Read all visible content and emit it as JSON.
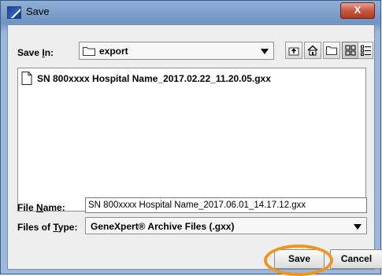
{
  "window": {
    "title": "Save",
    "close_label": "X"
  },
  "save_in": {
    "label_prefix": "Save ",
    "label_mnemonic": "I",
    "label_suffix": "n:",
    "value": "export"
  },
  "toolbar": {
    "icons": [
      "up-folder-icon",
      "home-icon",
      "new-folder-icon",
      "list-view-icon",
      "details-view-icon"
    ],
    "active": "list-view-icon"
  },
  "file_list": {
    "items": [
      {
        "name": "SN 800xxxx Hospital Name_2017.02.22_11.20.05.gxx",
        "icon": "document-icon"
      }
    ]
  },
  "file_name": {
    "label_prefix": "File ",
    "label_mnemonic": "N",
    "label_suffix": "ame:",
    "value": "SN 800xxxx Hospital Name_2017.06.01_14.17.12.gxx"
  },
  "files_of_type": {
    "label_prefix": "Files of ",
    "label_mnemonic": "T",
    "label_suffix": "ype:",
    "value": "GeneXpert® Archive Files (.gxx)"
  },
  "buttons": {
    "save": "Save",
    "cancel": "Cancel"
  },
  "colors": {
    "highlight": "#f0961c",
    "close": "#c75945",
    "frame": "#6f94c2"
  }
}
